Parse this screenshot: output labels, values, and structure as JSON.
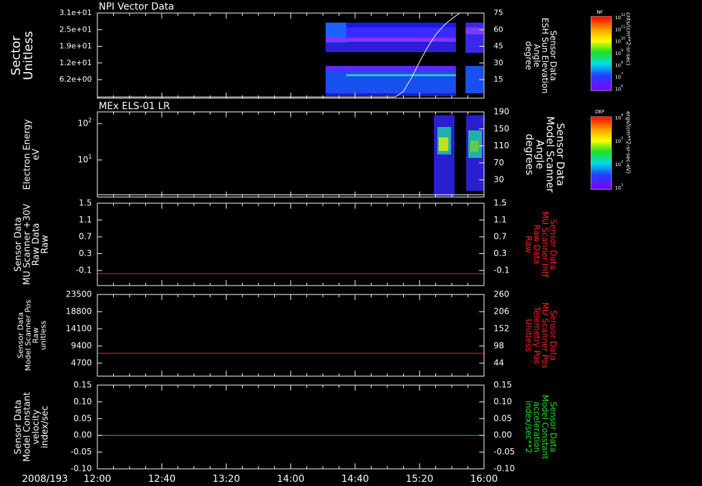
{
  "date_label": "2008/193",
  "time_axis": {
    "ticks": [
      "12:00",
      "12:40",
      "13:20",
      "14:00",
      "14:40",
      "15:20",
      "16:00"
    ],
    "range_minutes": [
      0,
      240
    ]
  },
  "colors": {
    "red_trace": "#ff2020",
    "green_trace": "#00e000",
    "red_label": "#ff2020",
    "green_label": "#20e020"
  },
  "panels": [
    {
      "title": "NPI Vector Data",
      "left_label": [
        "Sector",
        "Unitless"
      ],
      "right_label": [
        "Sensor Data",
        "ESH Sun Elevation",
        "Angle",
        "degree"
      ],
      "right_label_color": "white",
      "left_ticks": [
        "3.1e+01",
        "2.5e+01",
        "1.9e+01",
        "1.2e+01",
        "6.2e+00"
      ],
      "right_ticks": [
        "75",
        "60",
        "45",
        "30",
        "15"
      ]
    },
    {
      "title": "MEx ELS-01 LR",
      "left_label": [
        "Electron Energy",
        "eV"
      ],
      "right_label": [
        "Sensor Data",
        "Model Scanner",
        "Angle",
        "degrees"
      ],
      "right_label_color": "white",
      "left_ticks": [
        "10^2",
        "10^1"
      ],
      "right_ticks": [
        "190",
        "150",
        "110",
        "70",
        "30"
      ]
    },
    {
      "title": "",
      "left_label": [
        "Sensor Data",
        "MU Scanner +30V",
        "Raw Data",
        "Raw"
      ],
      "right_label": [
        "Sensor Data",
        "MU Scanner Intf",
        "Raw Data",
        "Raw"
      ],
      "right_label_color": "red",
      "left_ticks": [
        "1.5",
        "1.1",
        "0.7",
        "0.3",
        "-0.1"
      ],
      "right_ticks": [
        "1.5",
        "1.1",
        "0.7",
        "0.3",
        "-0.1"
      ]
    },
    {
      "title": "",
      "left_label": [
        "Sensor Data",
        "Model Scanner Pos",
        "Raw",
        "unitless"
      ],
      "right_label": [
        "Sensor Data",
        "MU Scanner Pos",
        "Telemetry Pos",
        "Unitless"
      ],
      "right_label_color": "red",
      "left_ticks": [
        "23500",
        "18800",
        "14100",
        "9400",
        "4700"
      ],
      "right_ticks": [
        "260",
        "206",
        "152",
        "98",
        "44"
      ]
    },
    {
      "title": "",
      "left_label": [
        "Sensor Data",
        "Model Constant",
        "velocity",
        "index/sec"
      ],
      "right_label": [
        "Sensor Data",
        "Model Constant",
        "acceleration",
        "index/sec**2"
      ],
      "right_label_color": "green",
      "left_ticks": [
        "0.15",
        "0.10",
        "0.05",
        "0.00",
        "-0.05",
        "-0.10"
      ],
      "right_ticks": [
        "0.15",
        "0.10",
        "0.05",
        "0.00",
        "-0.05",
        "-0.10"
      ]
    }
  ],
  "colorbars": [
    {
      "name": "NF",
      "unit_label": "cnts/(cm**2-sr-sec)",
      "tick_labels": [
        "10^12",
        "10^11",
        "10^10",
        "10^9",
        "10^8",
        "10^7",
        "10^6"
      ]
    },
    {
      "name": "DEF",
      "unit_label": "ergs/(cm**2-sr-sec-eV)",
      "tick_labels": [
        "10^4",
        "10^3",
        "10^2",
        "10^1"
      ]
    }
  ],
  "chart_data": [
    {
      "type": "line",
      "title": "NPI Vector Data",
      "ylabel": "Sector Unitless",
      "y2label": "Sensor Data ESH Sun Elevation Angle degree",
      "y2lim": [
        0,
        75
      ],
      "series": [
        {
          "name": "Sensor Data ESH Sun Elevation Angle",
          "axis": "right",
          "x_minutes": [
            0,
            185,
            190,
            195,
            200,
            205,
            210,
            215,
            220,
            225,
            230,
            240
          ],
          "values": [
            1,
            1,
            6,
            18,
            32,
            45,
            56,
            64,
            70,
            75,
            75,
            75
          ]
        }
      ]
    },
    {
      "type": "line",
      "title": "MEx ELS-01 LR",
      "ylabel": "Electron Energy eV",
      "y2label": "Sensor Data Model Scanner Angle degrees",
      "y2lim": [
        0,
        190
      ],
      "series": [
        {
          "name": "Sensor Data Model Scanner Angle",
          "axis": "right",
          "x_minutes": [
            0,
            240
          ],
          "values": [
            5,
            5
          ]
        }
      ]
    },
    {
      "type": "line",
      "ylabel": "Sensor Data MU Scanner +30V Raw Data Raw",
      "y2label": "Sensor Data MU Scanner Intf Raw Data Raw",
      "ylim": [
        -0.3,
        1.5
      ],
      "series": [
        {
          "name": "Sensor Data MU Scanner Intf Raw Data",
          "axis": "right",
          "x_minutes": [
            0,
            240
          ],
          "values": [
            -0.04,
            -0.04
          ]
        }
      ]
    },
    {
      "type": "line",
      "ylabel": "Sensor Data Model Scanner Pos Raw unitless",
      "y2label": "Sensor Data MU Scanner Pos Telemetry Pos Unitless",
      "ylim": [
        0,
        23500
      ],
      "y2lim": [
        0,
        260
      ],
      "series": [
        {
          "name": "Sensor Data MU Scanner Pos Telemetry Pos",
          "axis": "right",
          "x_minutes": [
            0,
            240
          ],
          "values": [
            73,
            73
          ]
        }
      ]
    },
    {
      "type": "line",
      "ylabel": "Sensor Data Model Constant velocity index/sec",
      "y2label": "Sensor Data Model Constant acceleration index/sec**2",
      "ylim": [
        -0.1,
        0.15
      ],
      "series": [
        {
          "name": "Sensor Data Model Constant acceleration",
          "axis": "right",
          "x_minutes": [
            0,
            240
          ],
          "values": [
            0.0,
            0.0
          ]
        }
      ]
    }
  ]
}
